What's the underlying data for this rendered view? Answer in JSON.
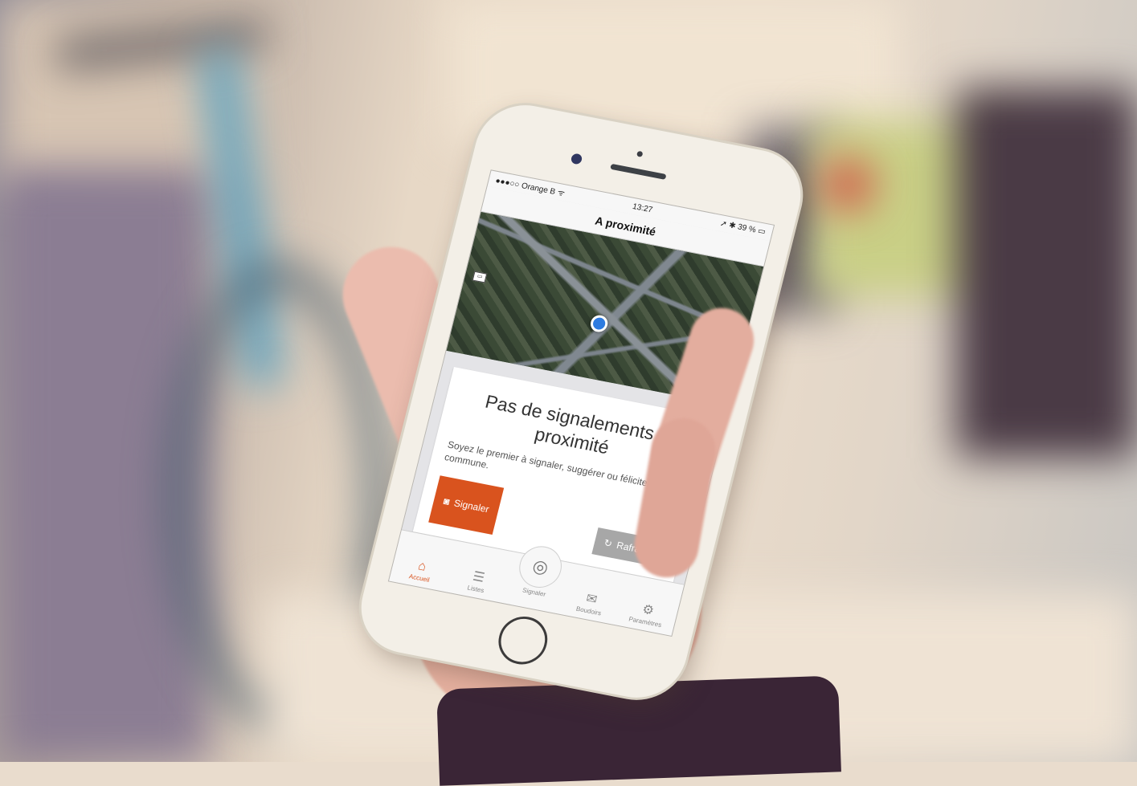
{
  "status_bar": {
    "carrier": "●●●○○ Orange B ᯤ",
    "time": "13:27",
    "battery": "➚ ✱ 39 % ▭"
  },
  "nav": {
    "title": "A proximité"
  },
  "map": {
    "badge": "▭"
  },
  "card": {
    "title": "Pas de signalements à proximité",
    "message": "Soyez le premier à signaler, suggérer ou féliciter votre commune.",
    "primary_button": "Signaler",
    "secondary_button": "Rafraichir"
  },
  "tabs": [
    {
      "label": "Accueil",
      "icon": "home-icon",
      "glyph": "⌂"
    },
    {
      "label": "Listes",
      "icon": "list-icon",
      "glyph": "☰"
    },
    {
      "label": "Signaler",
      "icon": "camera-icon",
      "glyph": "◎"
    },
    {
      "label": "Boudoirs",
      "icon": "inbox-icon",
      "glyph": "✉"
    },
    {
      "label": "Paramètres",
      "icon": "gear-icon",
      "glyph": "⚙"
    }
  ],
  "colors": {
    "accent": "#d9531e",
    "secondary_button": "#a7a7a7",
    "location_dot": "#2e7be0"
  }
}
